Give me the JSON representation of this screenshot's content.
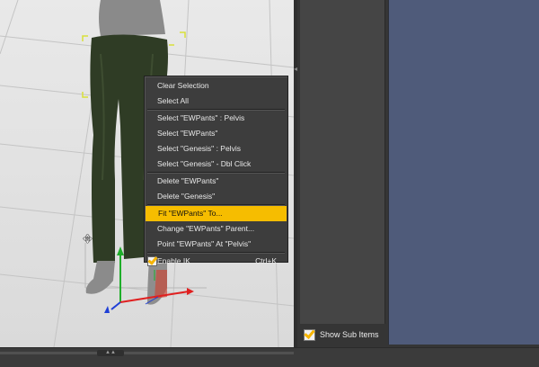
{
  "context_menu": {
    "items": [
      {
        "label": "Clear Selection"
      },
      {
        "label": "Select All"
      },
      {
        "label": "Select \"EWPants\" : Pelvis"
      },
      {
        "label": "Select \"EWPants\""
      },
      {
        "label": "Select \"Genesis\" : Pelvis"
      },
      {
        "label": "Select \"Genesis\" - Dbl Click"
      },
      {
        "label": "Delete \"EWPants\""
      },
      {
        "label": "Delete \"Genesis\""
      },
      {
        "label": "Fit \"EWPants\" To...",
        "highlighted": true
      },
      {
        "label": "Change \"EWPants\" Parent..."
      },
      {
        "label": "Point \"EWPants\" At \"Pelvis\""
      },
      {
        "label": "Enable IK",
        "shortcut": "Ctrl+K",
        "checked": true
      }
    ]
  },
  "side_panel": {
    "show_sub_items_label": "Show Sub Items",
    "show_sub_items_checked": true
  },
  "colors": {
    "menu_highlight": "#f6bd00",
    "panel_blue": "#4f5b7a",
    "axis_x": "#e02020",
    "axis_y": "#1fae2a",
    "axis_z": "#1f3fd6",
    "selection_bracket": "#d8e03a"
  }
}
